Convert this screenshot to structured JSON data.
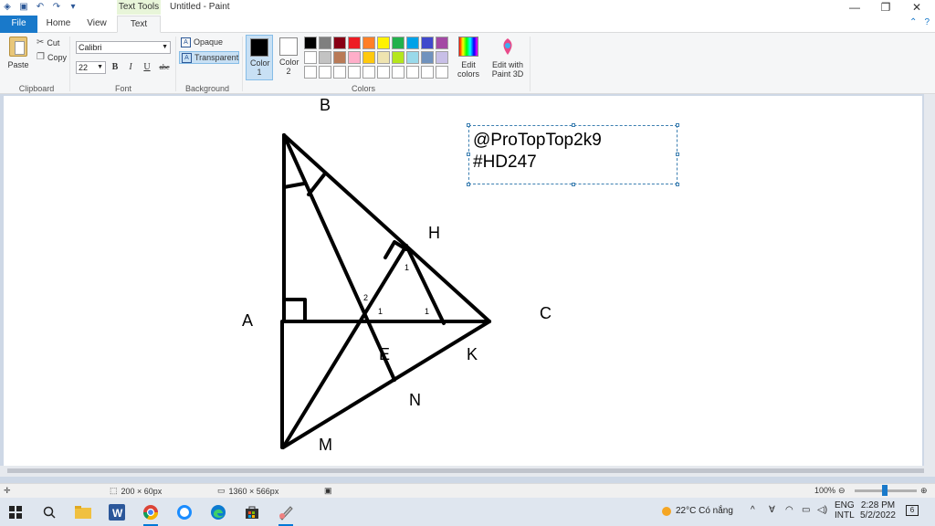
{
  "app": {
    "window_title": "Untitled - Paint",
    "context_tab": "Text Tools"
  },
  "tabs": [
    "File",
    "Home",
    "View",
    "Text"
  ],
  "ribbon": {
    "clipboard": {
      "paste": "Paste",
      "cut": "Cut",
      "copy": "Copy",
      "label": "Clipboard"
    },
    "font": {
      "name": "Calibri",
      "size": "22",
      "bold": "B",
      "italic": "I",
      "underline": "U",
      "strike": "abc",
      "label": "Font"
    },
    "background": {
      "opaque": "Opaque",
      "transparent": "Transparent",
      "label": "Background"
    },
    "colors": {
      "color1_label": "Color 1",
      "color2_label": "Color 2",
      "edit_colors": "Edit colors",
      "edit_3d": "Edit with Paint 3D",
      "label": "Colors",
      "color1": "#000000",
      "color2": "#ffffff",
      "palette": [
        "#000000",
        "#7f7f7f",
        "#880015",
        "#ed1c24",
        "#ff7f27",
        "#fff200",
        "#22b14c",
        "#00a2e8",
        "#3f48cc",
        "#a349a4",
        "#ffffff",
        "#c3c3c3",
        "#b97a57",
        "#ffaec9",
        "#ffc90e",
        "#efe4b0",
        "#b5e61d",
        "#99d9ea",
        "#7092be",
        "#c8bfe7",
        "#ffffff",
        "#ffffff",
        "#ffffff",
        "#ffffff",
        "#ffffff",
        "#ffffff",
        "#ffffff",
        "#ffffff",
        "#ffffff",
        "#ffffff"
      ]
    }
  },
  "canvas": {
    "textbox": "@ProTopTop2k9\n#HD247",
    "points": {
      "B": "B",
      "A": "A",
      "C": "C",
      "H": "H",
      "E": "E",
      "K": "K",
      "N": "N",
      "M": "M"
    },
    "angle_marks": [
      "1",
      "2",
      "1",
      "1"
    ]
  },
  "statusbar": {
    "selection_size": "200 × 60px",
    "image_size": "1360 × 566px",
    "zoom": "100%"
  },
  "taskbar": {
    "weather": "22°C  Có nắng",
    "lang": "ENG",
    "lang_sub": "INTL",
    "time": "2:28 PM",
    "date": "5/2/2022",
    "notif": "6"
  }
}
